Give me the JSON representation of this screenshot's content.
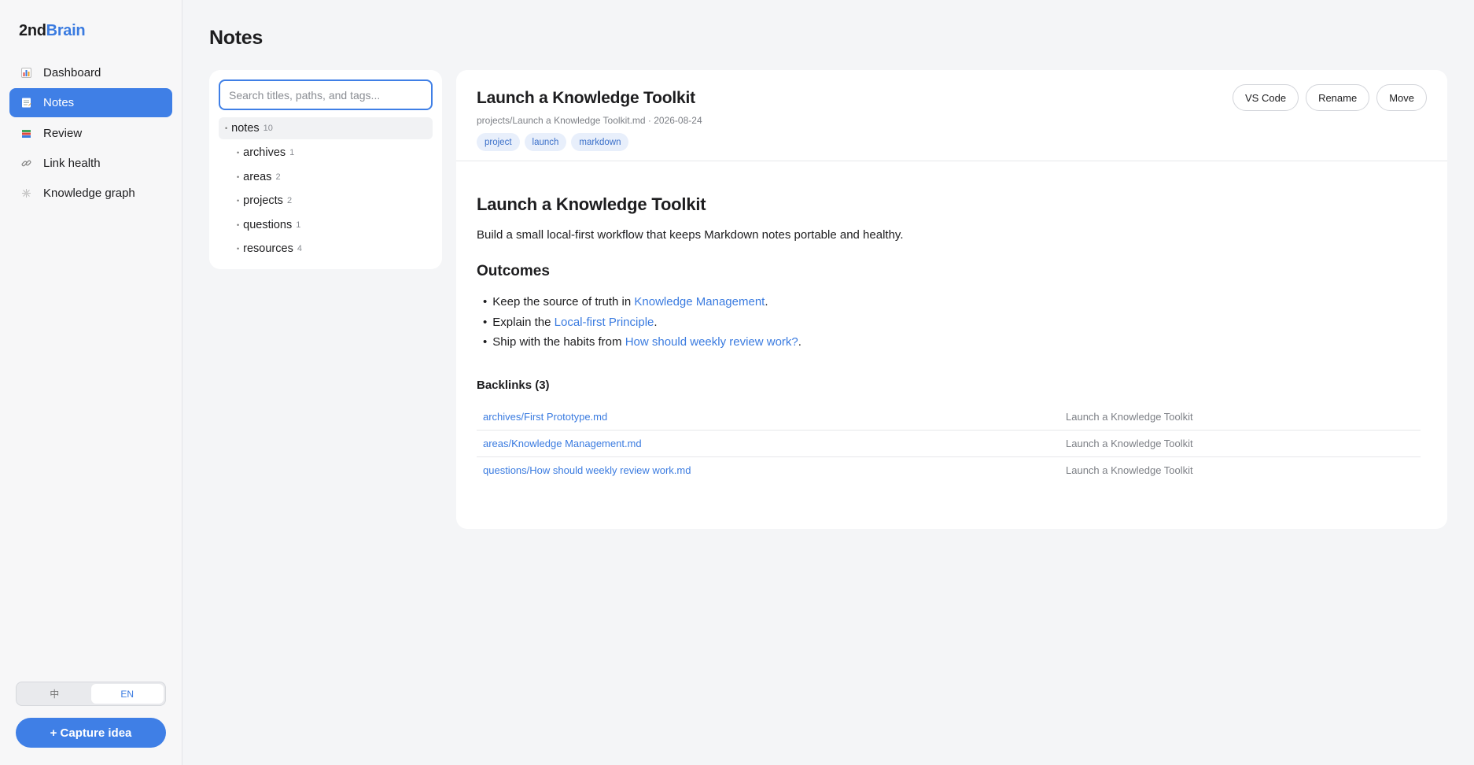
{
  "brand": {
    "prefix": "2nd",
    "accent": "Brain"
  },
  "nav": [
    {
      "label": "Dashboard",
      "icon": "bar-chart-icon",
      "active": false
    },
    {
      "label": "Notes",
      "icon": "memo-icon",
      "active": true
    },
    {
      "label": "Review",
      "icon": "books-icon",
      "active": false
    },
    {
      "label": "Link health",
      "icon": "link-icon",
      "active": false
    },
    {
      "label": "Knowledge graph",
      "icon": "graph-icon",
      "active": false
    }
  ],
  "lang": {
    "zh": "中",
    "en": "EN",
    "selected": "EN"
  },
  "capture_label": "+ Capture idea",
  "page_title": "Notes",
  "search": {
    "placeholder": "Search titles, paths, and tags...",
    "value": ""
  },
  "tree": {
    "root": {
      "name": "notes",
      "count": "10"
    },
    "folders": [
      {
        "name": "archives",
        "count": "1"
      },
      {
        "name": "areas",
        "count": "2"
      },
      {
        "name": "projects",
        "count": "2"
      },
      {
        "name": "questions",
        "count": "1"
      },
      {
        "name": "resources",
        "count": "4"
      }
    ]
  },
  "note": {
    "title": "Launch a Knowledge Toolkit",
    "meta": "projects/Launch a Knowledge Toolkit.md · 2026-08-24",
    "tags": [
      "project",
      "launch",
      "markdown"
    ],
    "actions": [
      "VS Code",
      "Rename",
      "Move"
    ],
    "body": {
      "h1": "Launch a Knowledge Toolkit",
      "intro": "Build a small local-first workflow that keeps Markdown notes portable and healthy.",
      "h2": "Outcomes",
      "outcomes": [
        {
          "before": "Keep the source of truth in ",
          "link": "Knowledge Management",
          "after": "."
        },
        {
          "before": "Explain the ",
          "link": "Local-first Principle",
          "after": "."
        },
        {
          "before": "Ship with the habits from ",
          "link": "How should weekly review work?",
          "after": "."
        }
      ]
    },
    "backlinks_title": "Backlinks (3)",
    "backlinks": [
      {
        "path": "archives/First Prototype.md",
        "context": "Launch a Knowledge Toolkit"
      },
      {
        "path": "areas/Knowledge Management.md",
        "context": "Launch a Knowledge Toolkit"
      },
      {
        "path": "questions/How should weekly review work.md",
        "context": "Launch a Knowledge Toolkit"
      }
    ]
  },
  "colors": {
    "accent": "#3f7fe6",
    "link": "#3a7be0",
    "tag_bg": "#e8effb",
    "page_bg": "#f4f5f7"
  }
}
